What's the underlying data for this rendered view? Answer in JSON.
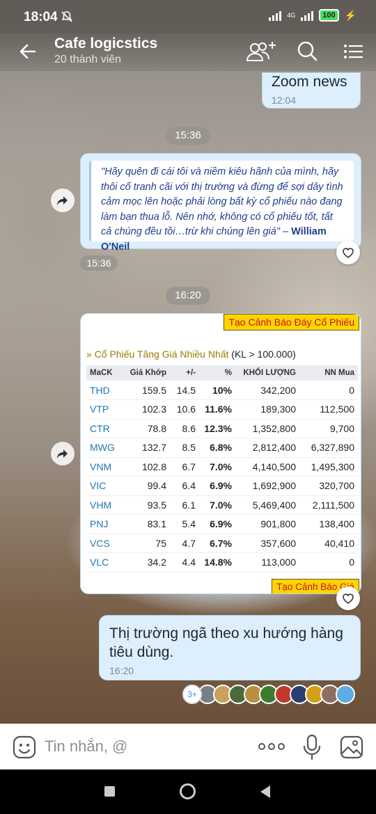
{
  "status_bar": {
    "time": "18:04",
    "lte": "4G",
    "battery": "100"
  },
  "header": {
    "title": "Cafe logicstics",
    "subtitle": "20 thành viên",
    "icons": [
      "back-arrow-icon",
      "add-member-icon",
      "search-icon",
      "menu-list-icon"
    ]
  },
  "messages": {
    "zoom": {
      "text": "Zoom news",
      "time": "12:04"
    },
    "divider1": "15:36",
    "quote": {
      "text": "\"Hãy quên đi cái tôi và niềm kiêu hãnh của mình, hãy thôi cố tranh cãi với thị trường và đừng để sợi dây tình cảm mọc lên hoặc phải lòng bất kỳ cổ phiếu nào đang làm bạn thua lỗ. Nên nhớ, không có cổ phiếu tốt, tất cả chúng đều tồi…trừ khi chúng lên giá\" – ",
      "author": "William O'Neil",
      "time": "15:36"
    },
    "divider2": "16:20",
    "stock_image": {
      "banner_top": "Tạo Cảnh Báo Đáy Cổ Phiếu",
      "banner_bottom": "Tạo Cảnh Báo Giá",
      "heading_prefix": "» Cổ Phiếu Tăng Giá Nhiều Nhất",
      "heading_suffix": " (KL > 100.000)",
      "columns": [
        "MaCK",
        "Giá Khớp",
        "+/-",
        "%",
        "KHỐI LƯỢNG",
        "NN Mua"
      ],
      "rows": [
        [
          "THD",
          "159.5",
          "14.5",
          "10%",
          "342,200",
          "0"
        ],
        [
          "VTP",
          "102.3",
          "10.6",
          "11.6%",
          "189,300",
          "112,500"
        ],
        [
          "CTR",
          "78.8",
          "8.6",
          "12.3%",
          "1,352,800",
          "9,700"
        ],
        [
          "MWG",
          "132.7",
          "8.5",
          "6.8%",
          "2,812,400",
          "6,327,890"
        ],
        [
          "VNM",
          "102.8",
          "6.7",
          "7.0%",
          "4,140,500",
          "1,495,300"
        ],
        [
          "VIC",
          "99.4",
          "6.4",
          "6.9%",
          "1,692,900",
          "320,700"
        ],
        [
          "VHM",
          "93.5",
          "6.1",
          "7.0%",
          "5,469,400",
          "2,111,500"
        ],
        [
          "PNJ",
          "83.1",
          "5.4",
          "6.9%",
          "901,800",
          "138,400"
        ],
        [
          "VCS",
          "75",
          "4.7",
          "6.7%",
          "357,600",
          "40,410"
        ],
        [
          "VLC",
          "34.2",
          "4.4",
          "14.8%",
          "113,000",
          "0"
        ]
      ]
    },
    "last": {
      "text": "Thị trường ngã theo xu hướng hàng tiêu dùng.",
      "time": "16:20"
    },
    "reactions_more": "3+"
  },
  "input": {
    "placeholder": "Tin nhắn, @",
    "icons": [
      "emoji-icon",
      "more-options-icon",
      "microphone-icon",
      "image-icon"
    ]
  },
  "colors": {
    "bubble": "#ddeffc",
    "quote_text": "#1f3e8c",
    "banner_yellow": "#ffd500",
    "symbol_blue": "#1f77b4"
  }
}
